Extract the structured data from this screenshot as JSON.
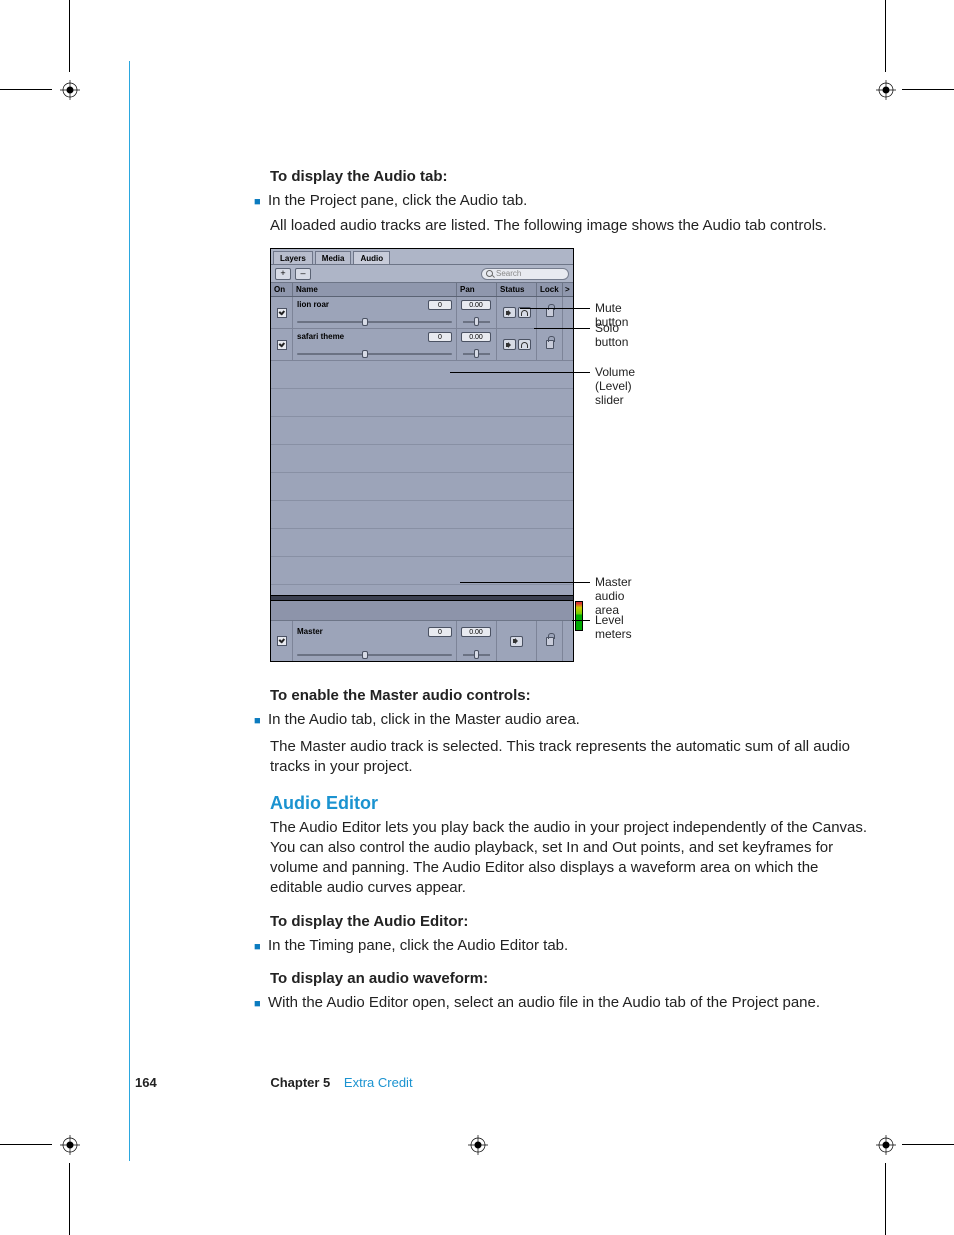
{
  "headings": {
    "h1": "To display the Audio tab:",
    "h2": "To enable the Master audio controls:",
    "h3": "Audio Editor",
    "h4": "To display the Audio Editor:",
    "h5": "To display an audio waveform:"
  },
  "bullets": {
    "b1": "In the Project pane, click the Audio tab.",
    "b2": "In the Audio tab, click in the Master audio area.",
    "b3": "In the Timing pane, click the Audio Editor tab.",
    "b4": "With the Audio Editor open, select an audio file in the Audio tab of the Project pane."
  },
  "paragraphs": {
    "p1": "All loaded audio tracks are listed. The following image shows the Audio tab controls.",
    "p2": "The Master audio track is selected. This track represents the automatic sum of all audio tracks in your project.",
    "p3": "The Audio Editor lets you play back the audio in your project independently of the Canvas. You can also control the audio playback, set In and Out points, and set keyframes for volume and panning. The Audio Editor also displays a waveform area on which the editable audio curves appear."
  },
  "panel": {
    "tabs": {
      "layers": "Layers",
      "media": "Media",
      "audio": "Audio"
    },
    "toolbar": {
      "add": "+",
      "remove": "–"
    },
    "search_placeholder": "Search",
    "columns": {
      "on": "On",
      "name": "Name",
      "pan": "Pan",
      "status": "Status",
      "lock": "Lock",
      "end": ">"
    },
    "tracks": [
      {
        "name": "lion roar",
        "level": "0",
        "pan": "0.00",
        "slider_pct": 42
      },
      {
        "name": "safari theme",
        "level": "0",
        "pan": "0.00",
        "slider_pct": 42
      }
    ],
    "master": {
      "name": "Master",
      "level": "0",
      "pan": "0.00",
      "slider_pct": 42
    }
  },
  "callouts": {
    "mute": "Mute button",
    "solo": "Solo button",
    "volume": "Volume (Level) slider",
    "master_area": "Master audio area",
    "meters": "Level meters"
  },
  "footer": {
    "page": "164",
    "chapter": "Chapter 5",
    "title": "Extra Credit"
  }
}
